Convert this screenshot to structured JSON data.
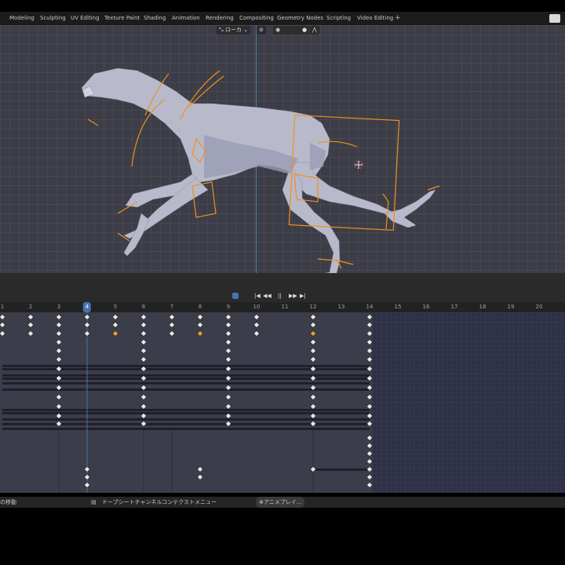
{
  "workspace_tabs": [
    "Modeling",
    "Sculpting",
    "UV Editing",
    "Texture Paint",
    "Shading",
    "Animation",
    "Rendering",
    "Compositing",
    "Geometry Nodes",
    "Scripting",
    "Video Editing"
  ],
  "add_tab": "+",
  "viewport": {
    "orientation_label": "ローカ",
    "chevron": "⌄"
  },
  "timeline": {
    "playback_controls": [
      "|◀",
      "◀◀",
      "||",
      "▶▶",
      "▶|"
    ],
    "current_frame": 4,
    "frame_labels": [
      "1",
      "2",
      "3",
      "4",
      "5",
      "6",
      "7",
      "8",
      "9",
      "10",
      "11",
      "12",
      "13",
      "14",
      "15",
      "16",
      "17",
      "18",
      "19",
      "20"
    ]
  },
  "status_bar": {
    "left_text": "の移動",
    "middle_text": "ドープシートチャンネルコンテクストメニュー",
    "right_text": "アニメプレイ..."
  },
  "colors": {
    "accent": "#4772b3",
    "key_selected": "#f0a030",
    "key_default": "#e8e8e8",
    "bone_orange": "#f09020"
  }
}
